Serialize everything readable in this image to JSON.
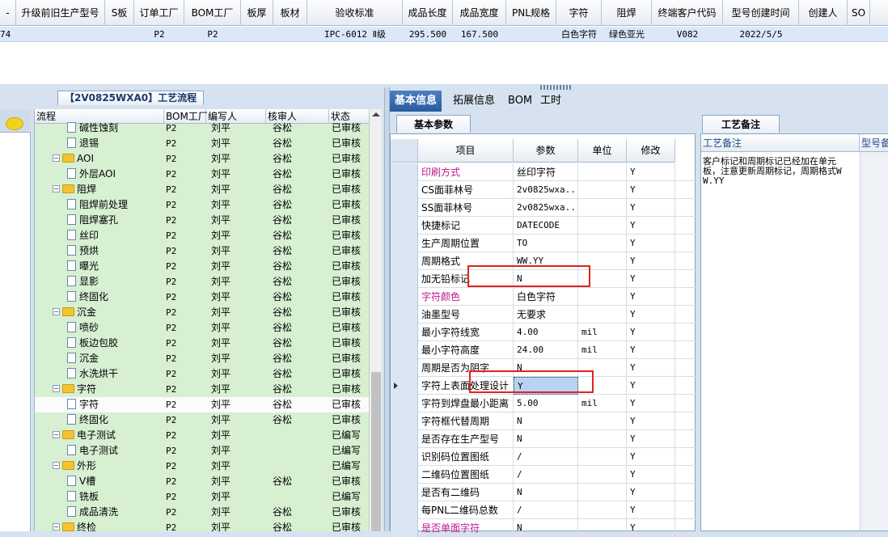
{
  "top_grid": {
    "headers": [
      "-",
      "升级前旧生产型号",
      "S板",
      "订单工厂",
      "BOM工厂",
      "板厚",
      "板材",
      "验收标准",
      "成品长度",
      "成品宽度",
      "PNL规格",
      "字符",
      "阻焊",
      "终端客户代码",
      "型号创建时间",
      "创建人",
      "SO"
    ],
    "row": [
      "74",
      "",
      "",
      "P2",
      "P2",
      "",
      "",
      "IPC-6012 Ⅱ级",
      "295.500",
      "167.500",
      "",
      "白色字符",
      "绿色亚光",
      "V082",
      "2022/5/5",
      "",
      ""
    ]
  },
  "process_panel": {
    "title": "【2V0825WXA0】工艺流程",
    "headers": [
      "流程",
      "BOM工厂",
      "编写人",
      "核审人",
      "状态"
    ],
    "rows": [
      {
        "kind": "doc",
        "name": "碱性蚀刻",
        "bom": "P2",
        "writer": "刘平",
        "reviewer": "谷松",
        "status": "已审核"
      },
      {
        "kind": "doc",
        "name": "退锡",
        "bom": "P2",
        "writer": "刘平",
        "reviewer": "谷松",
        "status": "已审核"
      },
      {
        "kind": "folder",
        "name": "AOI",
        "bom": "P2",
        "writer": "刘平",
        "reviewer": "谷松",
        "status": "已审核"
      },
      {
        "kind": "doc",
        "name": "外层AOI",
        "bom": "P2",
        "writer": "刘平",
        "reviewer": "谷松",
        "status": "已审核"
      },
      {
        "kind": "folder",
        "name": "阻焊",
        "bom": "P2",
        "writer": "刘平",
        "reviewer": "谷松",
        "status": "已审核"
      },
      {
        "kind": "doc",
        "name": "阻焊前处理",
        "bom": "P2",
        "writer": "刘平",
        "reviewer": "谷松",
        "status": "已审核"
      },
      {
        "kind": "doc",
        "name": "阻焊塞孔",
        "bom": "P2",
        "writer": "刘平",
        "reviewer": "谷松",
        "status": "已审核"
      },
      {
        "kind": "doc",
        "name": "丝印",
        "bom": "P2",
        "writer": "刘平",
        "reviewer": "谷松",
        "status": "已审核"
      },
      {
        "kind": "doc",
        "name": "预烘",
        "bom": "P2",
        "writer": "刘平",
        "reviewer": "谷松",
        "status": "已审核"
      },
      {
        "kind": "doc",
        "name": "曝光",
        "bom": "P2",
        "writer": "刘平",
        "reviewer": "谷松",
        "status": "已审核"
      },
      {
        "kind": "doc",
        "name": "显影",
        "bom": "P2",
        "writer": "刘平",
        "reviewer": "谷松",
        "status": "已审核"
      },
      {
        "kind": "doc",
        "name": "终固化",
        "bom": "P2",
        "writer": "刘平",
        "reviewer": "谷松",
        "status": "已审核"
      },
      {
        "kind": "folder",
        "name": "沉金",
        "bom": "P2",
        "writer": "刘平",
        "reviewer": "谷松",
        "status": "已审核"
      },
      {
        "kind": "doc",
        "name": "喷砂",
        "bom": "P2",
        "writer": "刘平",
        "reviewer": "谷松",
        "status": "已审核"
      },
      {
        "kind": "doc",
        "name": "板边包胶",
        "bom": "P2",
        "writer": "刘平",
        "reviewer": "谷松",
        "status": "已审核"
      },
      {
        "kind": "doc",
        "name": "沉金",
        "bom": "P2",
        "writer": "刘平",
        "reviewer": "谷松",
        "status": "已审核"
      },
      {
        "kind": "doc",
        "name": "水洗烘干",
        "bom": "P2",
        "writer": "刘平",
        "reviewer": "谷松",
        "status": "已审核"
      },
      {
        "kind": "folder",
        "name": "字符",
        "bom": "P2",
        "writer": "刘平",
        "reviewer": "谷松",
        "status": "已审核"
      },
      {
        "kind": "doc",
        "name": "字符",
        "bom": "P2",
        "writer": "刘平",
        "reviewer": "谷松",
        "status": "已审核",
        "selected": true
      },
      {
        "kind": "doc",
        "name": "终固化",
        "bom": "P2",
        "writer": "刘平",
        "reviewer": "谷松",
        "status": "已审核"
      },
      {
        "kind": "folder",
        "name": "电子测试",
        "bom": "P2",
        "writer": "刘平",
        "reviewer": "",
        "status": "已编写"
      },
      {
        "kind": "doc",
        "name": "电子测试",
        "bom": "P2",
        "writer": "刘平",
        "reviewer": "",
        "status": "已编写"
      },
      {
        "kind": "folder",
        "name": "外形",
        "bom": "P2",
        "writer": "刘平",
        "reviewer": "",
        "status": "已编写"
      },
      {
        "kind": "doc",
        "name": "V槽",
        "bom": "P2",
        "writer": "刘平",
        "reviewer": "谷松",
        "status": "已审核"
      },
      {
        "kind": "doc",
        "name": "铣板",
        "bom": "P2",
        "writer": "刘平",
        "reviewer": "",
        "status": "已编写"
      },
      {
        "kind": "doc",
        "name": "成品清洗",
        "bom": "P2",
        "writer": "刘平",
        "reviewer": "谷松",
        "status": "已审核"
      },
      {
        "kind": "folder",
        "name": "终检",
        "bom": "P2",
        "writer": "刘平",
        "reviewer": "谷松",
        "status": "已审核"
      }
    ]
  },
  "tabs": [
    "基本信息",
    "拓展信息",
    "BOM",
    "工时"
  ],
  "base_panel": {
    "subtab": "基本参数",
    "headers": [
      "项目",
      "参数",
      "单位",
      "修改"
    ],
    "rows": [
      {
        "item": "印刷方式",
        "param": "丝印字符",
        "unit": "",
        "mod": "Y",
        "pink": true
      },
      {
        "item": "CS面菲林号",
        "param": "2v0825wxa...",
        "unit": "",
        "mod": "Y"
      },
      {
        "item": "SS面菲林号",
        "param": "2v0825wxa...",
        "unit": "",
        "mod": "Y"
      },
      {
        "item": "快捷标记",
        "param": "DATECODE",
        "unit": "",
        "mod": "Y"
      },
      {
        "item": "生产周期位置",
        "param": "TO",
        "unit": "",
        "mod": "Y"
      },
      {
        "item": "周期格式",
        "param": "WW.YY",
        "unit": "",
        "mod": "Y"
      },
      {
        "item": "加无铅标记",
        "param": "N",
        "unit": "",
        "mod": "Y"
      },
      {
        "item": "字符颜色",
        "param": "白色字符",
        "unit": "",
        "mod": "Y",
        "pink": true
      },
      {
        "item": "油墨型号",
        "param": "无要求",
        "unit": "",
        "mod": "Y"
      },
      {
        "item": "最小字符线宽",
        "param": "4.00",
        "unit": "mil",
        "mod": "Y"
      },
      {
        "item": "最小字符高度",
        "param": "24.00",
        "unit": "mil",
        "mod": "Y"
      },
      {
        "item": "周期是否为阴字",
        "param": "N",
        "unit": "",
        "mod": "Y"
      },
      {
        "item": "字符上表面处理设计",
        "param": "Y",
        "unit": "",
        "mod": "Y",
        "current": true
      },
      {
        "item": "字符到焊盘最小距离",
        "param": "5.00",
        "unit": "mil",
        "mod": "Y"
      },
      {
        "item": "字符框代替周期",
        "param": "N",
        "unit": "",
        "mod": "Y"
      },
      {
        "item": "是否存在生产型号",
        "param": "N",
        "unit": "",
        "mod": "Y"
      },
      {
        "item": "识别码位置图纸",
        "param": "/",
        "unit": "",
        "mod": "Y"
      },
      {
        "item": "二维码位置图纸",
        "param": "/",
        "unit": "",
        "mod": "Y"
      },
      {
        "item": "是否有二维码",
        "param": "N",
        "unit": "",
        "mod": "Y"
      },
      {
        "item": "每PNL二维码总数",
        "param": "/",
        "unit": "",
        "mod": "Y"
      },
      {
        "item": "是否单面字符",
        "param": "N",
        "unit": "",
        "mod": "Y",
        "pink": true
      }
    ]
  },
  "note_panel": {
    "tab": "工艺备注",
    "col1": "工艺备注",
    "col2": "型号备注",
    "text": "客户标记和周期标记已经加在单元板，注意更新周期标记，周期格式WW.YY"
  },
  "colors": {
    "pink": "#c0178c",
    "highlight": "#e0231e",
    "accent": "#2a5a9e"
  }
}
